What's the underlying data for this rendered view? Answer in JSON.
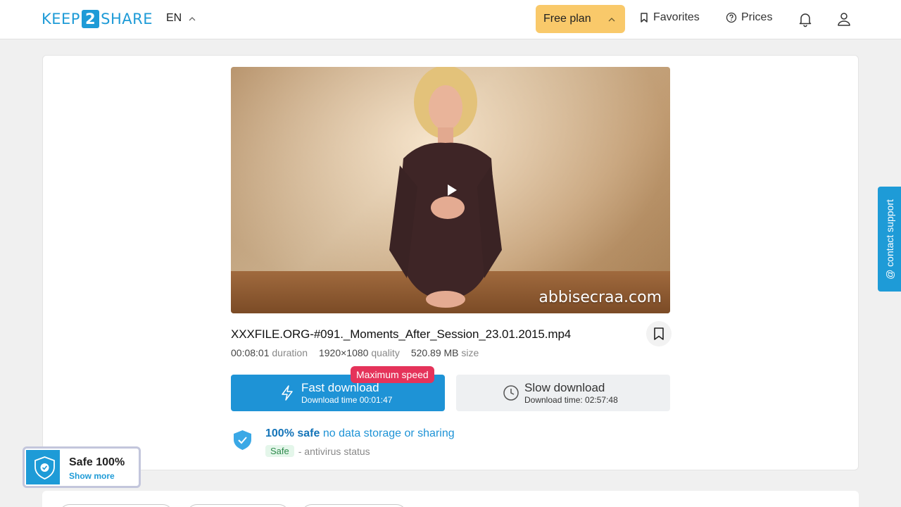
{
  "header": {
    "logo_left": "KEEP",
    "logo_mid": "2",
    "logo_right": "SHARE",
    "language": "EN",
    "plan_label": "Free plan",
    "favorites_label": "Favorites",
    "prices_label": "Prices"
  },
  "video": {
    "watermark": "abbisecraa.com"
  },
  "file": {
    "name": "XXXFILE.ORG-#091._Moments_After_Session_23.01.2015.mp4",
    "duration": "00:08:01",
    "duration_label": "duration",
    "quality": "1920×1080",
    "quality_label": "quality",
    "size": "520.89 MB",
    "size_label": "size"
  },
  "download": {
    "badge": "Maximum speed",
    "fast_label": "Fast download",
    "fast_time": "Download time 00:01:47",
    "slow_label": "Slow download",
    "slow_time": "Download time: 02:57:48"
  },
  "safety": {
    "headline_strong": "100% safe",
    "headline_rest": "no data storage or sharing",
    "tag": "Safe",
    "status_text": "- antivirus status"
  },
  "contact_support": "@ contact support",
  "safe_popup": {
    "title": "Safe 100%",
    "link": "Show more"
  },
  "colors": {
    "brand": "#1e9bd7",
    "plan": "#f9c96a",
    "badge": "#e5335a"
  }
}
